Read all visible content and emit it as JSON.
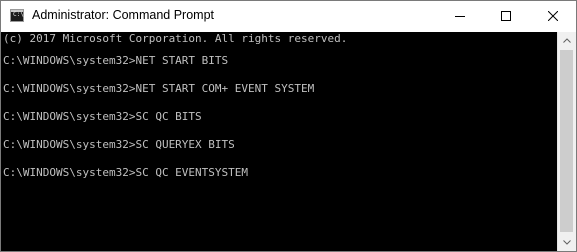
{
  "window": {
    "title": "Administrator: Command Prompt",
    "icons": {
      "app": "cmd-icon",
      "minimize": "minimize-icon",
      "maximize": "maximize-icon",
      "close": "close-icon",
      "scroll_up": "chevron-up-icon",
      "scroll_down": "chevron-down-icon"
    }
  },
  "console": {
    "lines": [
      "(c) 2017 Microsoft Corporation. All rights reserved.",
      "",
      "C:\\WINDOWS\\system32>NET START BITS",
      "",
      "C:\\WINDOWS\\system32>NET START COM+ EVENT SYSTEM",
      "",
      "C:\\WINDOWS\\system32>SC QC BITS",
      "",
      "C:\\WINDOWS\\system32>SC QUERYEX BITS",
      "",
      "C:\\WINDOWS\\system32>SC QC EVENTSYSTEM"
    ]
  },
  "colors": {
    "console_background": "#000000",
    "console_text": "#c0c0c0",
    "titlebar_background": "#ffffff"
  }
}
